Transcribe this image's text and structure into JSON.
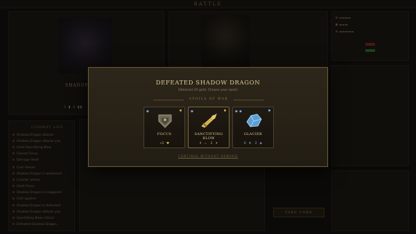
{
  "header": {
    "title": "BATTLE"
  },
  "enemy": {
    "name": "SHADOW",
    "stats": "5  ▮ 3  ▮▮"
  },
  "battle_log": {
    "title": "COMBAT LOG",
    "lines": [
      "Shadow Dragon attacks",
      "Shadow Dragon attacks you",
      "Used Sanctifying Blow",
      "Gained Focus",
      "Damage dealt",
      "Cast Glacier",
      "Shadow Dragon is weakened",
      "Counter attack",
      "Used Focus",
      "Shadow Dragon is staggered",
      "Chill applied",
      "Shadow Dragon is defeated!",
      "Shadow Dragon attacks you",
      "Sanctifying Blow critical",
      "Defeated Shadow Dragon"
    ]
  },
  "right_panel": {
    "button_label": "TAKE CARD"
  },
  "modal": {
    "title": "DEFEATED SHADOW DRAGON",
    "subtitle": "Obtained 20 gold. Choose your spoils",
    "section_label": "SPOILS OF WAR",
    "cards": [
      {
        "name": "FOCUS",
        "cost_a": "+2",
        "cost_a_icon": "shield-icon",
        "cost_b": "",
        "accent": "#c9a24e"
      },
      {
        "name": "SANCTIFYING BLOW",
        "cost_a": "4",
        "cost_a_icon": "flame-icon",
        "cost_b": "2",
        "cost_b_icon": "star-icon",
        "accent": "#d4a93c"
      },
      {
        "name": "GLACIER",
        "cost_a": "6",
        "cost_a_icon": "frost-icon",
        "cost_b": "2",
        "cost_b_icon": "gem-icon",
        "accent": "#6fb6e8"
      }
    ],
    "footer_link": "CONTINUE WITHOUT REWARD"
  },
  "colors": {
    "modal_border": "#6b5a34",
    "title_gold": "#e3cf98",
    "frost_blue": "#6fb6e8"
  }
}
